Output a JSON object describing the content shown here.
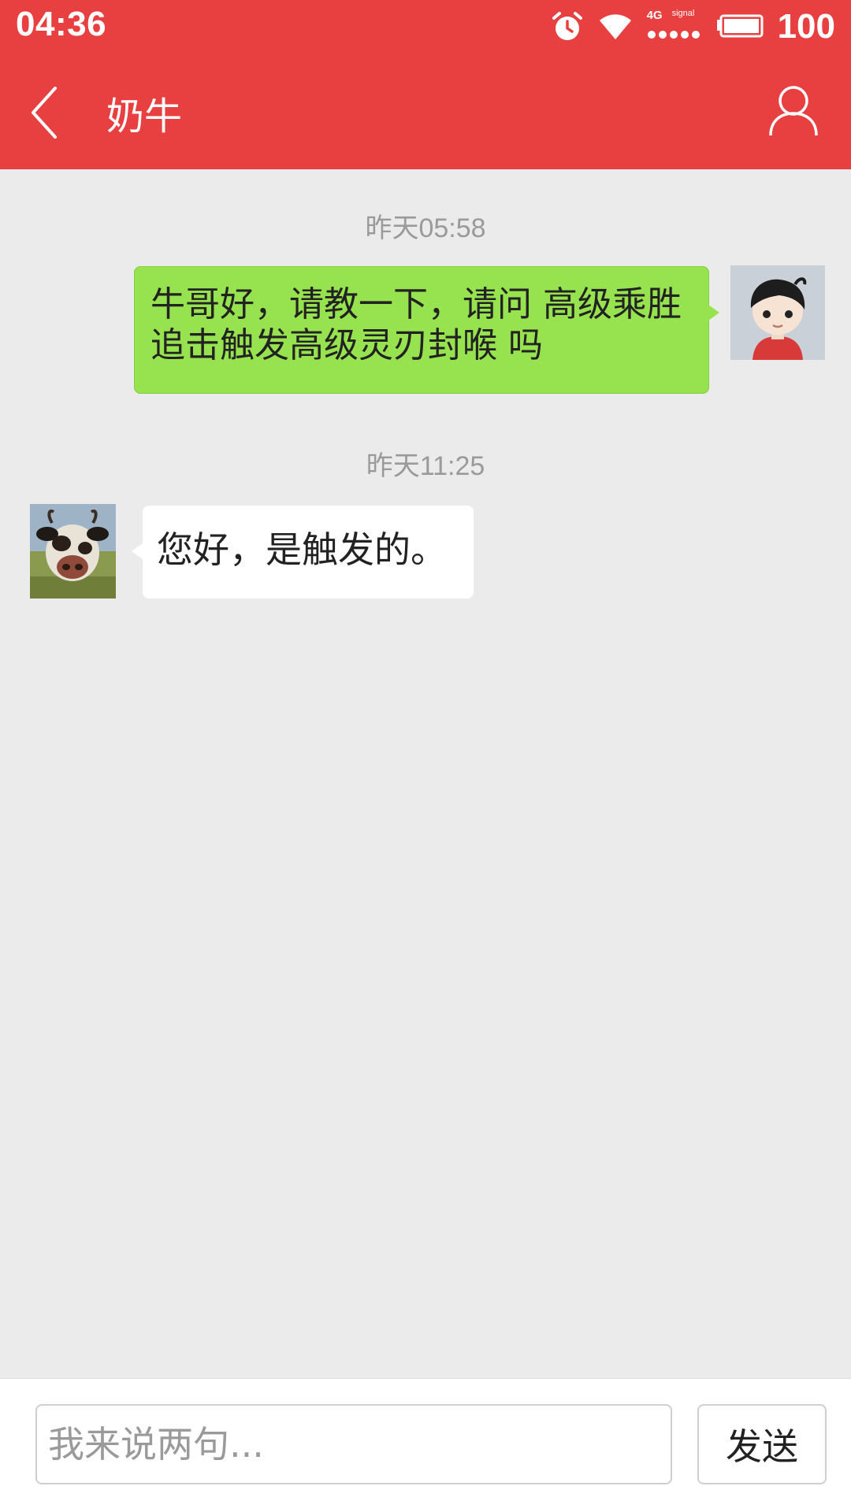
{
  "status_bar": {
    "time": "04:36",
    "network_label": "4G",
    "signal_label": "signal",
    "battery_percent": "100",
    "icons": [
      "alarm-icon",
      "wifi-icon",
      "cellular-signal-icon",
      "battery-icon"
    ]
  },
  "header": {
    "title": "奶牛",
    "back_icon": "chevron-left-icon",
    "profile_icon": "person-icon"
  },
  "chat": {
    "messages": [
      {
        "timestamp": "昨天05:58",
        "direction": "outgoing",
        "text": "牛哥好，请教一下，请问 高级乘胜追击触发高级灵刃封喉 吗"
      },
      {
        "timestamp": "昨天11:25",
        "direction": "incoming",
        "text": "您好，是触发的。"
      }
    ]
  },
  "composer": {
    "placeholder": "我来说两句...",
    "value": "",
    "send_label": "发送"
  },
  "colors": {
    "header_bg": "#e84040",
    "chat_bg": "#ebebeb",
    "outgoing_bubble": "#97e24f",
    "incoming_bubble": "#ffffff"
  }
}
